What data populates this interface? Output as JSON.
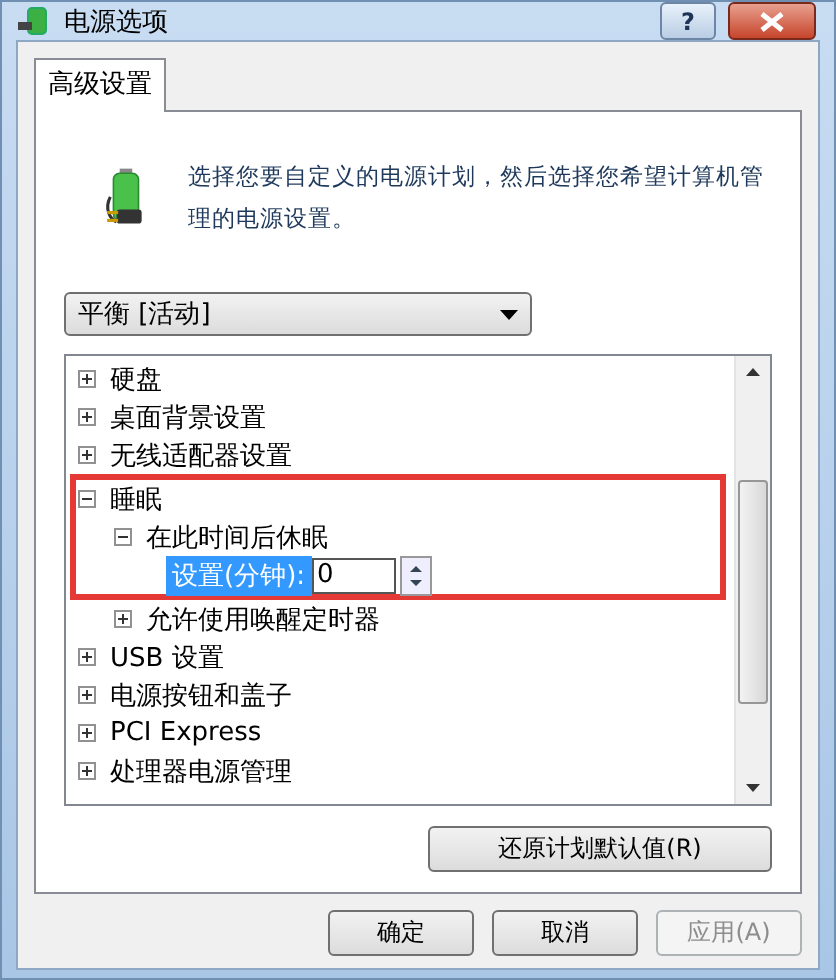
{
  "window": {
    "title": "电源选项",
    "help_label": "?"
  },
  "tabs": [
    {
      "label": "高级设置",
      "selected": true
    }
  ],
  "intro": "选择您要自定义的电源计划，然后选择您希望计算机管理的电源设置。",
  "plan_dropdown": {
    "value": "平衡 [活动]"
  },
  "tree": [
    {
      "label": "硬盘",
      "kind": "group",
      "expanded": false
    },
    {
      "label": "桌面背景设置",
      "kind": "group",
      "expanded": false
    },
    {
      "label": "无线适配器设置",
      "kind": "group",
      "expanded": false
    },
    {
      "label": "睡眠",
      "kind": "group",
      "expanded": true,
      "annotated": true,
      "children": [
        {
          "label": "在此时间后休眠",
          "kind": "group",
          "expanded": true,
          "children": [
            {
              "kind": "spinner",
              "label": "设置(分钟):",
              "value": "0",
              "selected": true
            }
          ]
        },
        {
          "label": "允许使用唤醒定时器",
          "kind": "group",
          "expanded": false
        }
      ]
    },
    {
      "label": "USB 设置",
      "kind": "group",
      "expanded": false
    },
    {
      "label": "电源按钮和盖子",
      "kind": "group",
      "expanded": false
    },
    {
      "label": "PCI Express",
      "kind": "group",
      "expanded": false
    },
    {
      "label": "处理器电源管理",
      "kind": "group",
      "expanded": false
    }
  ],
  "restore_button": "还原计划默认值(R)",
  "buttons": [
    {
      "label": "确定",
      "disabled": false
    },
    {
      "label": "取消",
      "disabled": false
    },
    {
      "label": "应用(A)",
      "disabled": true
    }
  ]
}
